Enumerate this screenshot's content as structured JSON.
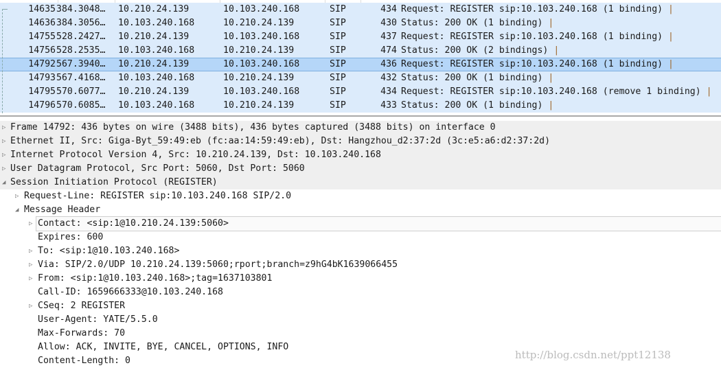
{
  "packets": [
    {
      "no": "14635",
      "time": "384.3048…",
      "src": "10.210.24.139",
      "dst": "10.103.240.168",
      "proto": "SIP",
      "len": "434",
      "info": "Request: REGISTER sip:10.103.240.168  (1 binding) ",
      "selected": false
    },
    {
      "no": "14636",
      "time": "384.3056…",
      "src": "10.103.240.168",
      "dst": "10.210.24.139",
      "proto": "SIP",
      "len": "430",
      "info": "Status: 200 OK  (1 binding) ",
      "selected": false
    },
    {
      "no": "14755",
      "time": "528.2427…",
      "src": "10.210.24.139",
      "dst": "10.103.240.168",
      "proto": "SIP",
      "len": "437",
      "info": "Request: REGISTER sip:10.103.240.168  (1 binding) ",
      "selected": false
    },
    {
      "no": "14756",
      "time": "528.2535…",
      "src": "10.103.240.168",
      "dst": "10.210.24.139",
      "proto": "SIP",
      "len": "474",
      "info": "Status: 200 OK  (2 bindings) ",
      "selected": false
    },
    {
      "no": "14792",
      "time": "567.3940…",
      "src": "10.210.24.139",
      "dst": "10.103.240.168",
      "proto": "SIP",
      "len": "436",
      "info": "Request: REGISTER sip:10.103.240.168  (1 binding) ",
      "selected": true
    },
    {
      "no": "14793",
      "time": "567.4168…",
      "src": "10.103.240.168",
      "dst": "10.210.24.139",
      "proto": "SIP",
      "len": "432",
      "info": "Status: 200 OK  (1 binding) ",
      "selected": false
    },
    {
      "no": "14795",
      "time": "570.6077…",
      "src": "10.210.24.139",
      "dst": "10.103.240.168",
      "proto": "SIP",
      "len": "434",
      "info": "Request: REGISTER sip:10.103.240.168  (remove 1 binding) ",
      "selected": false
    },
    {
      "no": "14796",
      "time": "570.6085…",
      "src": "10.103.240.168",
      "dst": "10.210.24.139",
      "proto": "SIP",
      "len": "433",
      "info": "Status: 200 OK  (1 binding) ",
      "selected": false
    }
  ],
  "details": [
    {
      "level": 0,
      "arrow": "collapsed",
      "text": "Frame 14792: 436 bytes on wire (3488 bits), 436 bytes captured (3488 bits) on interface 0"
    },
    {
      "level": 0,
      "arrow": "collapsed",
      "text": "Ethernet II, Src: Giga-Byt_59:49:eb (fc:aa:14:59:49:eb), Dst: Hangzhou_d2:37:2d (3c:e5:a6:d2:37:2d)"
    },
    {
      "level": 0,
      "arrow": "collapsed",
      "text": "Internet Protocol Version 4, Src: 10.210.24.139, Dst: 10.103.240.168"
    },
    {
      "level": 0,
      "arrow": "collapsed",
      "text": "User Datagram Protocol, Src Port: 5060, Dst Port: 5060"
    },
    {
      "level": 0,
      "arrow": "expanded",
      "text": "Session Initiation Protocol (REGISTER)"
    },
    {
      "level": 1,
      "arrow": "collapsed",
      "text": "Request-Line: REGISTER sip:10.103.240.168 SIP/2.0"
    },
    {
      "level": 1,
      "arrow": "expanded",
      "text": "Message Header"
    },
    {
      "level": 2,
      "arrow": "collapsed",
      "text": "Contact: <sip:1@10.210.24.139:5060>",
      "focused": true
    },
    {
      "level": 2,
      "arrow": "none",
      "text": "Expires: 600"
    },
    {
      "level": 2,
      "arrow": "collapsed",
      "text": "To: <sip:1@10.103.240.168>"
    },
    {
      "level": 2,
      "arrow": "collapsed",
      "text": "Via: SIP/2.0/UDP 10.210.24.139:5060;rport;branch=z9hG4bK1639066455"
    },
    {
      "level": 2,
      "arrow": "collapsed",
      "text": "From: <sip:1@10.103.240.168>;tag=1637103801"
    },
    {
      "level": 2,
      "arrow": "none",
      "text": "Call-ID: 1659666333@10.103.240.168"
    },
    {
      "level": 2,
      "arrow": "collapsed",
      "text": "CSeq: 2 REGISTER"
    },
    {
      "level": 2,
      "arrow": "none",
      "text": "User-Agent: YATE/5.5.0"
    },
    {
      "level": 2,
      "arrow": "none",
      "text": "Max-Forwards: 70"
    },
    {
      "level": 2,
      "arrow": "none",
      "text": "Allow: ACK, INVITE, BYE, CANCEL, OPTIONS, INFO"
    },
    {
      "level": 2,
      "arrow": "none",
      "text": "Content-Length: 0"
    }
  ],
  "watermark": "http://blog.csdn.net/ppt12138",
  "colors": {
    "row_bg": "#dcebfb",
    "selected_bg": "#b5d6f8",
    "tree_top_bg": "#efefef"
  }
}
